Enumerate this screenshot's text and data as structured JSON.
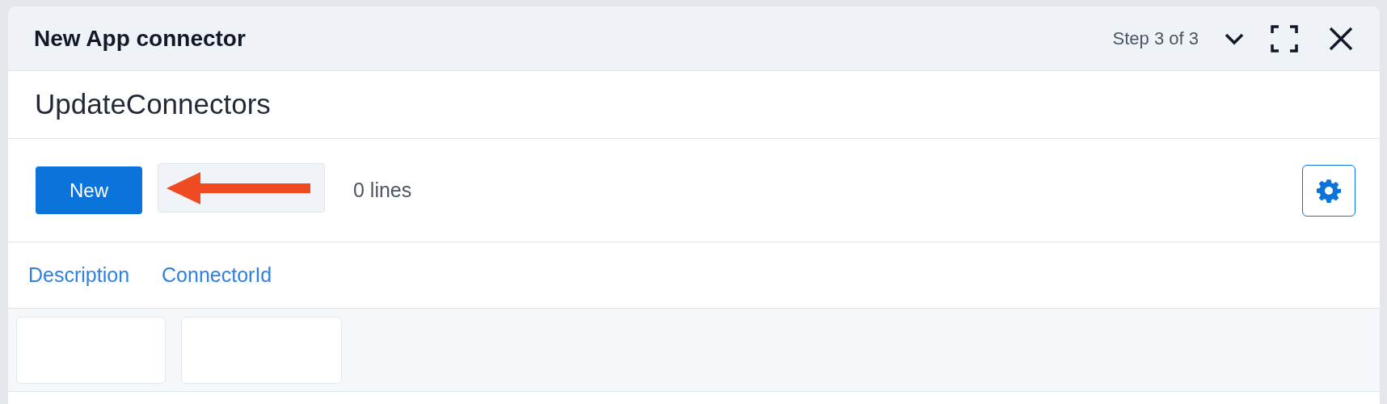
{
  "dialog": {
    "title": "New App connector",
    "step": "Step 3 of 3"
  },
  "record": {
    "name": "UpdateConnectors"
  },
  "toolbar": {
    "new_button": "New",
    "options_button": {
      "disabled": true
    },
    "line_count": "0 lines"
  },
  "table": {
    "columns": [
      "Description",
      "ConnectorId"
    ]
  }
}
